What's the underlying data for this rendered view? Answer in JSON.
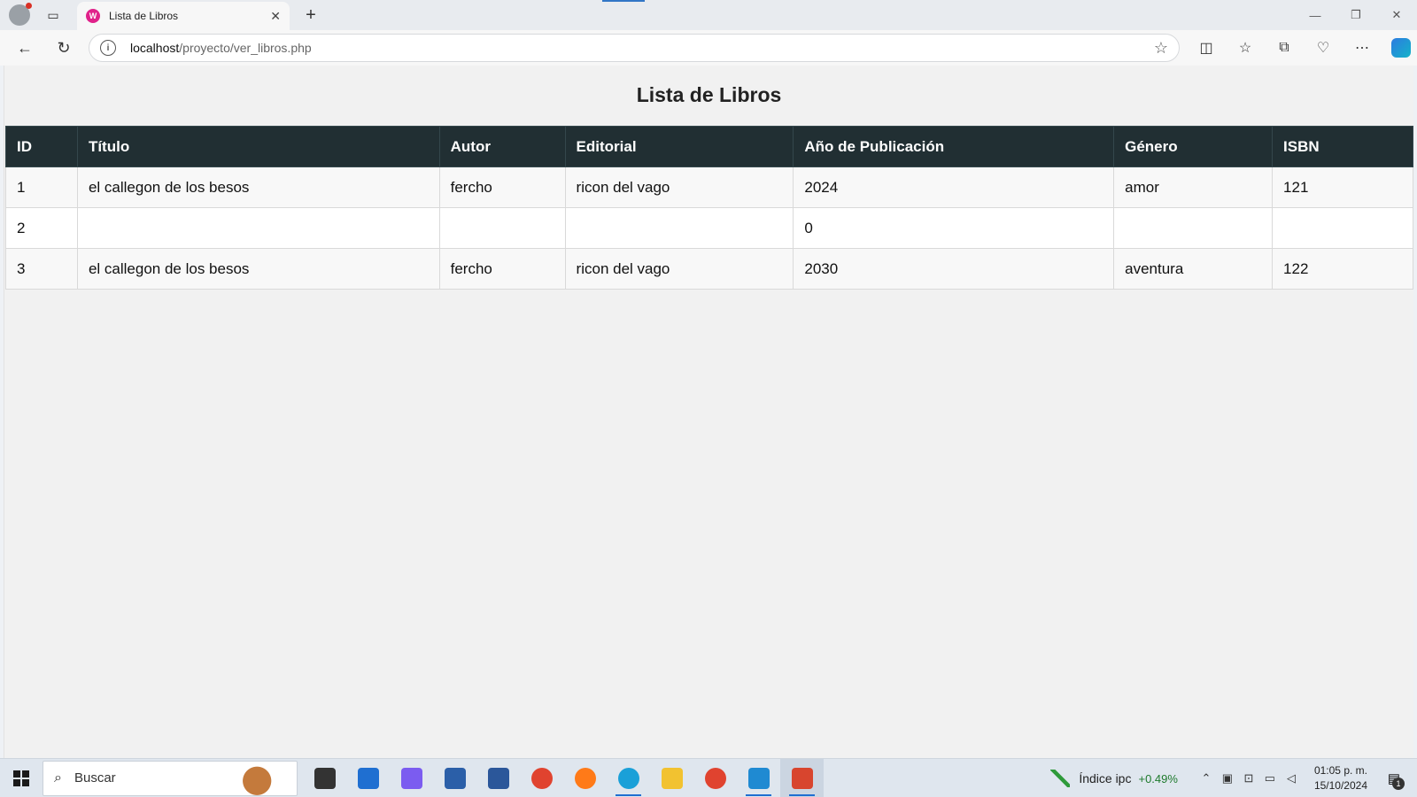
{
  "browser": {
    "tab_title": "Lista de Libros",
    "tab_favicon_text": "W",
    "address_host": "localhost",
    "address_path": "/proyecto/ver_libros.php"
  },
  "page": {
    "title": "Lista de Libros",
    "columns": [
      "ID",
      "Título",
      "Autor",
      "Editorial",
      "Año de Publicación",
      "Género",
      "ISBN"
    ],
    "rows": [
      [
        "1",
        "el callegon de los besos",
        "fercho",
        "ricon del vago",
        "2024",
        "amor",
        "121"
      ],
      [
        "2",
        "",
        "",
        "",
        "0",
        "",
        ""
      ],
      [
        "3",
        "el callegon de los besos",
        "fercho",
        "ricon del vago",
        "2030",
        "aventura",
        "122"
      ]
    ]
  },
  "taskbar": {
    "search_placeholder": "Buscar",
    "stock_name": "Índice ipc",
    "stock_change": "+0.49%",
    "time": "01:05 p. m.",
    "date": "15/10/2024",
    "notification_count": "1",
    "apps": [
      {
        "name": "task-view-icon",
        "color": "#333333"
      },
      {
        "name": "mail-icon",
        "color": "#1f6fd1"
      },
      {
        "name": "copilot-icon",
        "color": "#7b5cf0"
      },
      {
        "name": "store-icon",
        "color": "#2b5fa8"
      },
      {
        "name": "word-icon",
        "color": "#2b579a"
      },
      {
        "name": "chrome-icon",
        "color": "#e0432f"
      },
      {
        "name": "firefox-icon",
        "color": "#ff7a18"
      },
      {
        "name": "edge-icon",
        "color": "#1aa0d8"
      },
      {
        "name": "file-explorer-icon",
        "color": "#f2c230"
      },
      {
        "name": "chrome-icon",
        "color": "#e0432f"
      },
      {
        "name": "vscode-icon",
        "color": "#1f8ad2"
      },
      {
        "name": "paint-icon",
        "color": "#d8452e"
      }
    ]
  }
}
